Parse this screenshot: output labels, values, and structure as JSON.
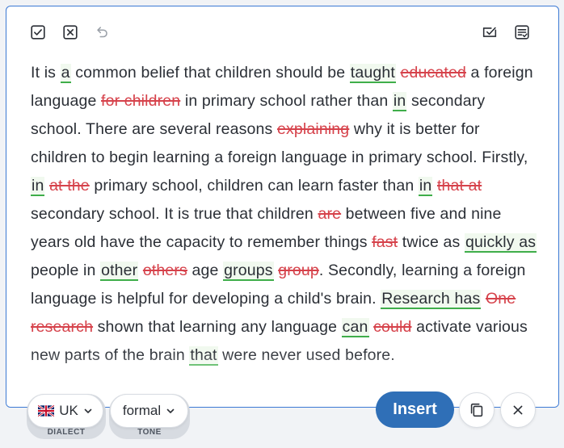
{
  "colors": {
    "accent": "#2f6fb7",
    "border_accent": "#3b79d4",
    "insertion": "#3fae4a",
    "deletion": "#d6424b",
    "text": "#2b2f36"
  },
  "toolbar": {
    "left_icons": [
      "check-square-icon",
      "x-square-icon",
      "undo-icon"
    ],
    "right_icons": [
      "checklist-icon",
      "document-check-icon"
    ]
  },
  "text_segments": [
    {
      "type": "text",
      "value": "It is "
    },
    {
      "type": "ins",
      "value": "a"
    },
    {
      "type": "text",
      "value": " common belief that children should be "
    },
    {
      "type": "ins",
      "value": "taught"
    },
    {
      "type": "text",
      "value": " "
    },
    {
      "type": "del",
      "value": "educated"
    },
    {
      "type": "text",
      "value": " a foreign language "
    },
    {
      "type": "del",
      "value": "for children"
    },
    {
      "type": "text",
      "value": " in primary school rather than "
    },
    {
      "type": "ins",
      "value": "in"
    },
    {
      "type": "text",
      "value": " secondary school. There are several reasons "
    },
    {
      "type": "del",
      "value": "explaining"
    },
    {
      "type": "text",
      "value": " why it is better for children to begin learning a foreign language in primary school. Firstly, "
    },
    {
      "type": "ins",
      "value": "in"
    },
    {
      "type": "text",
      "value": " "
    },
    {
      "type": "del",
      "value": "at the"
    },
    {
      "type": "text",
      "value": " primary school, children can learn faster than "
    },
    {
      "type": "ins",
      "value": "in"
    },
    {
      "type": "text",
      "value": " "
    },
    {
      "type": "del",
      "value": "that at"
    },
    {
      "type": "text",
      "value": " secondary school. It is true that children "
    },
    {
      "type": "del",
      "value": "are"
    },
    {
      "type": "text",
      "value": " between five and nine years old have the capacity to remember things "
    },
    {
      "type": "del",
      "value": "fast"
    },
    {
      "type": "text",
      "value": " twice as "
    },
    {
      "type": "ins",
      "value": "quickly as"
    },
    {
      "type": "text",
      "value": " people in "
    },
    {
      "type": "ins",
      "value": "other"
    },
    {
      "type": "text",
      "value": " "
    },
    {
      "type": "del",
      "value": "others"
    },
    {
      "type": "text",
      "value": " age "
    },
    {
      "type": "ins",
      "value": "groups"
    },
    {
      "type": "text",
      "value": " "
    },
    {
      "type": "del",
      "value": "group"
    },
    {
      "type": "text",
      "value": ". Secondly, learning a foreign language is helpful for developing a child's brain. "
    },
    {
      "type": "ins",
      "value": "Research has"
    },
    {
      "type": "text",
      "value": " "
    },
    {
      "type": "del",
      "value": "One research"
    },
    {
      "type": "text",
      "value": " shown that learning any language "
    },
    {
      "type": "ins",
      "value": "can"
    },
    {
      "type": "text",
      "value": " "
    },
    {
      "type": "del",
      "value": "could"
    },
    {
      "type": "text",
      "value": " activate various new parts of the brain "
    },
    {
      "type": "ins",
      "value": "that"
    },
    {
      "type": "text",
      "value": " were never used before."
    }
  ],
  "dialect": {
    "value": "UK",
    "caption": "DIALECT",
    "flag_icon": "uk-flag-icon"
  },
  "tone": {
    "value": "formal",
    "caption": "TONE"
  },
  "actions": {
    "insert_label": "Insert",
    "copy_icon": "copy-icon",
    "close_icon": "close-icon"
  }
}
